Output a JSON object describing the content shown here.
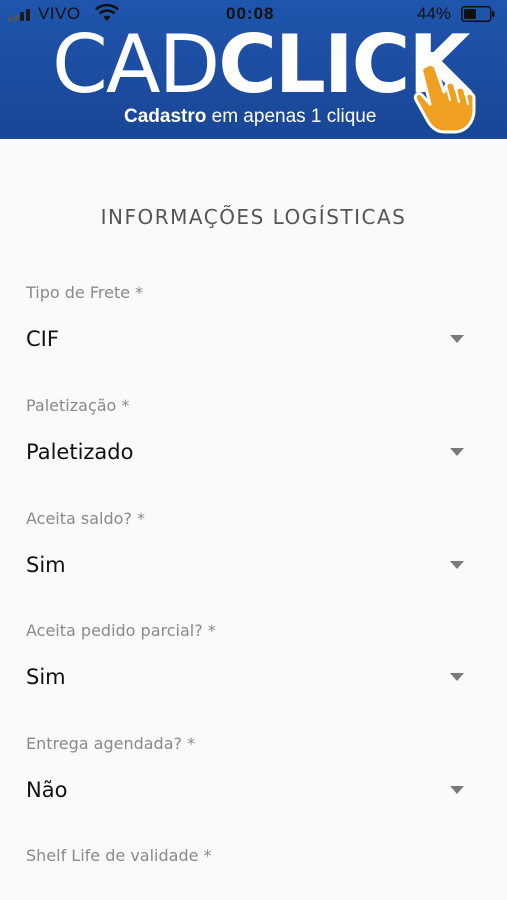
{
  "status_bar": {
    "carrier": "VIVO",
    "time": "00:08",
    "battery": "44%"
  },
  "header": {
    "logo_light": "CAD",
    "logo_bold": "CLICK",
    "tagline_strong": "Cadastro",
    "tagline_rest": " em apenas 1 clique",
    "icon": "pointing-hand-icon",
    "bg_color": "#1d4fa3",
    "accent_color": "#f0a020"
  },
  "section_title": "INFORMAÇÕES LOGÍSTICAS",
  "fields": [
    {
      "label": "Tipo de Frete *",
      "value": "CIF"
    },
    {
      "label": "Paletização *",
      "value": "Paletizado"
    },
    {
      "label": "Aceita saldo? *",
      "value": "Sim"
    },
    {
      "label": "Aceita pedido parcial? *",
      "value": "Sim"
    },
    {
      "label": "Entrega agendada? *",
      "value": "Não"
    },
    {
      "label": "Shelf Life de validade *"
    }
  ]
}
